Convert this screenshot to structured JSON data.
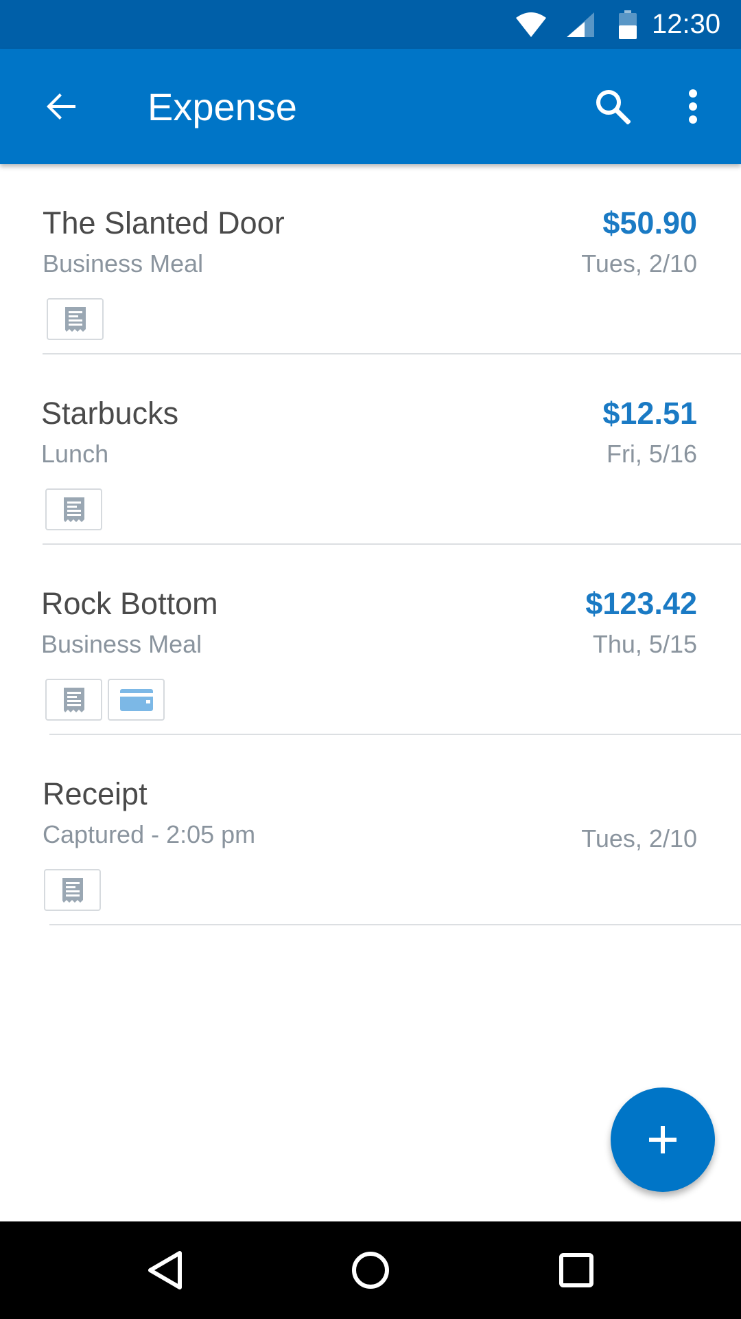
{
  "status_bar": {
    "time": "12:30",
    "icons": [
      "wifi-icon",
      "cell-signal-icon",
      "battery-icon"
    ]
  },
  "app_bar": {
    "title": "Expense",
    "icons": [
      "arrow-back-icon",
      "search-icon",
      "more-vert-icon"
    ]
  },
  "expenses": [
    {
      "name": "The Slanted Door",
      "category": "Business Meal",
      "amount": "$50.90",
      "date": "Tues, 2/10",
      "attachments": [
        "receipt-icon"
      ]
    },
    {
      "name": "Starbucks",
      "category": "Lunch",
      "amount": "$12.51",
      "date": "Fri, 5/16",
      "attachments": [
        "receipt-icon"
      ]
    },
    {
      "name": "Rock Bottom",
      "category": "Business Meal",
      "amount": "$123.42",
      "date": "Thu, 5/15",
      "attachments": [
        "receipt-icon",
        "credit-card-icon"
      ]
    },
    {
      "name": "Receipt",
      "category": "Captured - 2:05 pm",
      "amount": "",
      "date": "Tues, 2/10",
      "attachments": [
        "receipt-icon"
      ]
    }
  ],
  "fab": {
    "icon": "plus-icon"
  },
  "nav_bar": {
    "icons": [
      "nav-back-icon",
      "nav-home-icon",
      "nav-recents-icon"
    ]
  },
  "colors": {
    "status_bar": "#005fa8",
    "app_bar": "#0075c7",
    "amount": "#1a7ac4",
    "secondary_text": "#8a949e",
    "primary_text": "#4a4a4a"
  }
}
